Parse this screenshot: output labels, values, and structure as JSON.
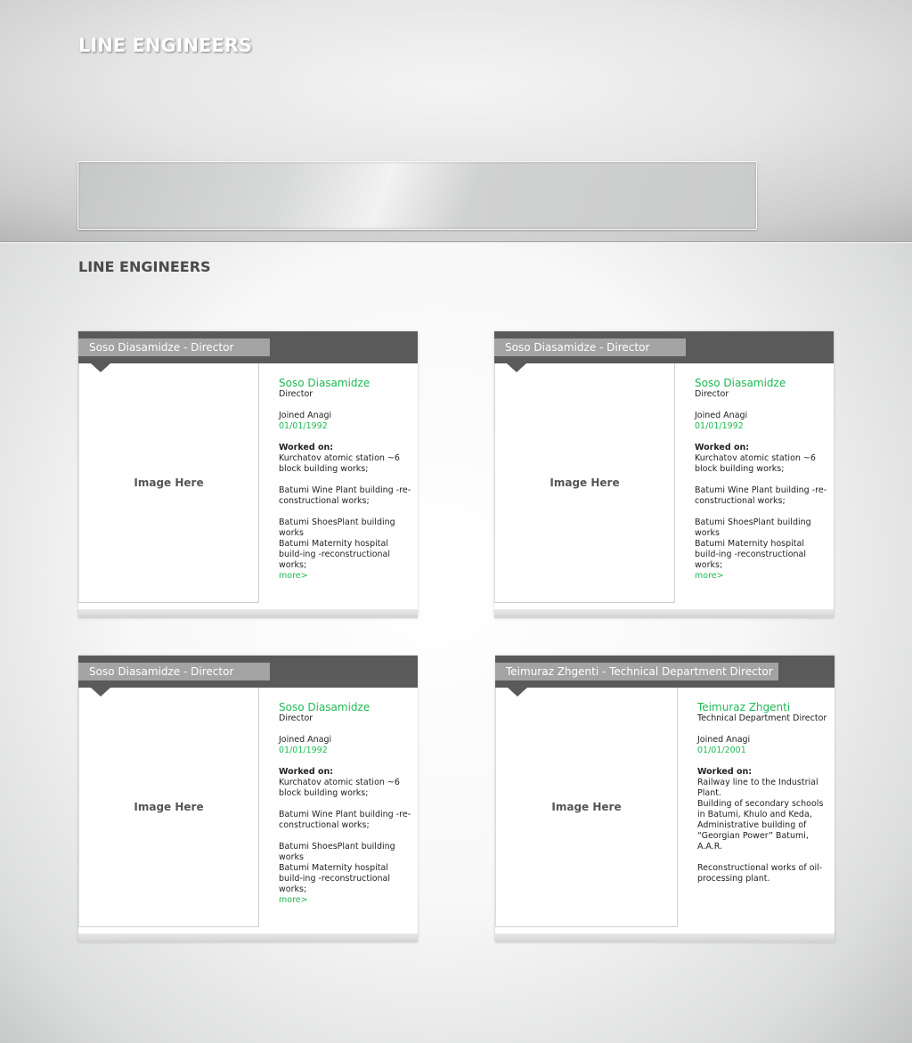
{
  "header": {
    "title": "LINE ENGINEERS"
  },
  "section": {
    "title": "LINE ENGINEERS"
  },
  "colors": {
    "accent": "#1db954",
    "card_header": "#5a5a5a",
    "card_tab": "#a3a3a3"
  },
  "cards": [
    {
      "tab": "Soso Diasamidze - Director",
      "image_placeholder": "Image Here",
      "name": "Soso Diasamidze",
      "role": "Director",
      "joined_label": "Joined Anagi",
      "joined_date": "01/01/1992",
      "worked_label": "Worked on:",
      "works": [
        "Kurchatov atomic station ~6 block building works;",
        "Batumi Wine Plant building -re-constructional works;",
        "Batumi ShoesPlant building works",
        "Batumi Maternity hospital build-ing -reconstructional works;"
      ],
      "more": "more>"
    },
    {
      "tab": "Soso Diasamidze - Director",
      "image_placeholder": "Image Here",
      "name": "Soso Diasamidze",
      "role": "Director",
      "joined_label": "Joined Anagi",
      "joined_date": "01/01/1992",
      "worked_label": "Worked on:",
      "works": [
        "Kurchatov atomic station ~6 block building works;",
        "Batumi Wine Plant building -re-constructional works;",
        "Batumi ShoesPlant building works",
        "Batumi Maternity hospital build-ing -reconstructional works;"
      ],
      "more": "more>"
    },
    {
      "tab": "Soso Diasamidze - Director",
      "image_placeholder": "Image Here",
      "name": "Soso Diasamidze",
      "role": "Director",
      "joined_label": "Joined Anagi",
      "joined_date": "01/01/1992",
      "worked_label": "Worked on:",
      "works": [
        "Kurchatov atomic station ~6 block building works;",
        "Batumi Wine Plant building -re-constructional works;",
        "Batumi ShoesPlant building works",
        "Batumi Maternity hospital build-ing -reconstructional works;"
      ],
      "more": "more>"
    },
    {
      "tab": "Teimuraz Zhgenti - Technical Department Director",
      "image_placeholder": "Image Here",
      "name": "Teimuraz Zhgenti",
      "role": "Technical Department Director",
      "joined_label": "Joined Anagi",
      "joined_date": "01/01/2001",
      "worked_label": "Worked on:",
      "works": [
        "Railway line to the Industrial Plant.",
        "Building of secondary schools in Batumi, Khulo and Keda,",
        "Administrative building of “Georgian Power” Batumi, A.A.R.",
        "Reconstructional works of oil-processing plant."
      ]
    }
  ]
}
